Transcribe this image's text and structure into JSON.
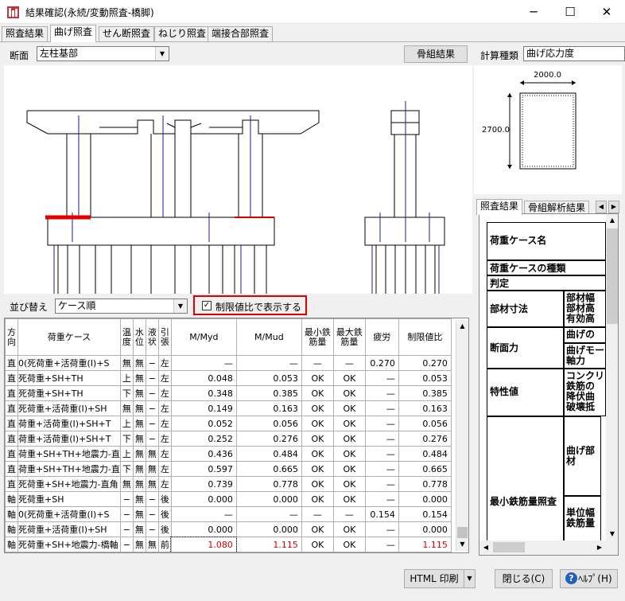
{
  "window": {
    "title": "結果確認(永続/変動照査-橋脚)",
    "minimize_glyph": "─",
    "maximize_glyph": "☐",
    "close_glyph": "✕",
    "icon": "app-icon"
  },
  "tabs": [
    {
      "label": "照査結果",
      "active": false
    },
    {
      "label": "曲げ照査",
      "active": true
    },
    {
      "label": "せん断照査",
      "active": false
    },
    {
      "label": "ねじり照査",
      "active": false
    },
    {
      "label": "端接合部照査",
      "active": false
    }
  ],
  "section": {
    "label": "断面",
    "value": "左柱基部",
    "frame_button": "骨組結果"
  },
  "calc": {
    "label": "計算種類",
    "value": "曲げ応力度"
  },
  "cross_section": {
    "width_label": "2000.0",
    "height_label": "2700.0"
  },
  "sort": {
    "label": "並び替え",
    "value": "ケース順",
    "checkbox_label": "制限値比で表示する",
    "checked": true
  },
  "table": {
    "headers": [
      "方向",
      "荷重ケース",
      "温度",
      "水位",
      "液状",
      "引張",
      "M/Myd",
      "M/Mud",
      "最小鉄筋量",
      "最大鉄筋量",
      "疲労",
      "制限値比"
    ],
    "rows": [
      [
        "直",
        "0(死荷重+活荷重(Ⅰ)+S",
        "無",
        "無",
        "−",
        "左",
        "—",
        "—",
        "—",
        "—",
        "0.270",
        "0.270"
      ],
      [
        "直",
        "死荷重+SH+TH",
        "上",
        "無",
        "−",
        "左",
        "0.048",
        "0.053",
        "OK",
        "OK",
        "—",
        "0.053"
      ],
      [
        "直",
        "死荷重+SH+TH",
        "下",
        "無",
        "−",
        "左",
        "0.348",
        "0.385",
        "OK",
        "OK",
        "—",
        "0.385"
      ],
      [
        "直",
        "死荷重+活荷重(Ⅰ)+SH",
        "無",
        "無",
        "−",
        "左",
        "0.149",
        "0.163",
        "OK",
        "OK",
        "—",
        "0.163"
      ],
      [
        "直",
        "荷重+活荷重(Ⅰ)+SH+T",
        "上",
        "無",
        "−",
        "左",
        "0.052",
        "0.056",
        "OK",
        "OK",
        "—",
        "0.056"
      ],
      [
        "直",
        "荷重+活荷重(Ⅰ)+SH+T",
        "下",
        "無",
        "−",
        "左",
        "0.252",
        "0.276",
        "OK",
        "OK",
        "—",
        "0.276"
      ],
      [
        "直",
        "荷重+SH+TH+地震力-直",
        "上",
        "無",
        "無",
        "左",
        "0.436",
        "0.484",
        "OK",
        "OK",
        "—",
        "0.484"
      ],
      [
        "直",
        "荷重+SH+TH+地震力-直",
        "下",
        "無",
        "無",
        "左",
        "0.597",
        "0.665",
        "OK",
        "OK",
        "—",
        "0.665"
      ],
      [
        "直",
        "死荷重+SH+地震力-直角",
        "無",
        "無",
        "無",
        "左",
        "0.739",
        "0.778",
        "OK",
        "OK",
        "—",
        "0.778"
      ],
      [
        "軸",
        "死荷重+SH",
        "−",
        "無",
        "−",
        "後",
        "0.000",
        "0.000",
        "OK",
        "OK",
        "—",
        "0.000"
      ],
      [
        "軸",
        "0(死荷重+活荷重(Ⅰ)+S",
        "−",
        "無",
        "−",
        "後",
        "—",
        "—",
        "—",
        "—",
        "0.154",
        "0.154"
      ],
      [
        "軸",
        "死荷重+活荷重(Ⅰ)+SH",
        "−",
        "無",
        "−",
        "後",
        "0.000",
        "0.000",
        "OK",
        "OK",
        "—",
        "0.000"
      ],
      [
        "軸",
        "死荷重+SH+地震力-橋軸",
        "−",
        "無",
        "無",
        "前",
        "1.080",
        "1.115",
        "OK",
        "OK",
        "—",
        "1.115"
      ]
    ],
    "highlight_row": 12,
    "highlight_color": "#e00000"
  },
  "right_tabs": [
    "照査結果",
    "骨組解析結果"
  ],
  "right_panel": {
    "load_case_name": "荷重ケース名",
    "load_case_type": "荷重ケースの種類",
    "judgment": "判定",
    "member_size": "部材寸法",
    "member_width": "部材幅",
    "member_height": "部材高",
    "effective_height": "有効高",
    "section_force": "断面力",
    "bending_label": "曲げの",
    "bending_moment": "曲げモー",
    "axial_force": "軸力",
    "characteristic": "特性値",
    "concrete": "コンクリ",
    "rebar": "鉄筋の",
    "yield_bending": "降伏曲",
    "failure": "破壊抵",
    "min_rebar_check": "最小鉄筋量照査",
    "bending_member": "曲げ部材",
    "unit_width": "単位幅",
    "rebar_amount": "鉄筋量"
  },
  "bottom": {
    "html_print": "HTML 印刷",
    "close": "閉じる(C)",
    "help": "ﾍﾙﾌﾟ(H)"
  },
  "colors": {
    "accent_red": "#e00000",
    "pile_blue": "#1a1aa0",
    "window_bg": "#f0f0f0"
  }
}
